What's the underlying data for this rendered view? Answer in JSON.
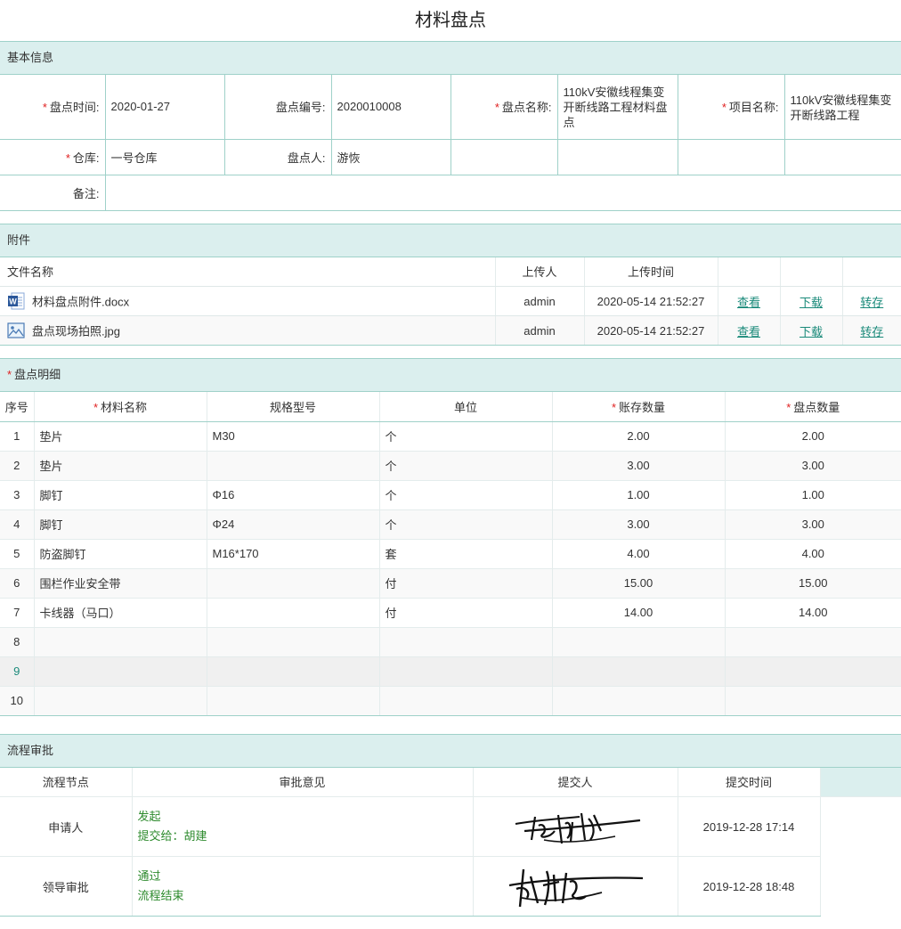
{
  "page": {
    "title": "材料盘点"
  },
  "basic": {
    "header": "基本信息",
    "date_label": "盘点时间:",
    "date_value": "2020-01-27",
    "no_label": "盘点编号:",
    "no_value": "2020010008",
    "name_label": "盘点名称:",
    "name_value": "110kV安徽线程集变开断线路工程材料盘点",
    "project_label": "项目名称:",
    "project_value": "110kV安徽线程集变开断线路工程",
    "warehouse_label": "仓库:",
    "warehouse_value": "一号仓库",
    "person_label": "盘点人:",
    "person_value": "游恢",
    "remark_label": "备注:",
    "remark_value": ""
  },
  "attachments": {
    "header": "附件",
    "columns": {
      "file": "文件名称",
      "uploader": "上传人",
      "time": "上传时间"
    },
    "files": [
      {
        "name": "材料盘点附件.docx",
        "icon": "word-file-icon",
        "uploader": "admin",
        "time": "2020-05-14 21:52:27",
        "view": "查看",
        "download": "下载",
        "save": "转存"
      },
      {
        "name": "盘点现场拍照.jpg",
        "icon": "image-file-icon",
        "uploader": "admin",
        "time": "2020-05-14 21:52:27",
        "view": "查看",
        "download": "下载",
        "save": "转存"
      }
    ]
  },
  "detail": {
    "header": "盘点明细",
    "columns": {
      "idx": "序号",
      "material": "材料名称",
      "spec": "规格型号",
      "unit": "单位",
      "stock": "账存数量",
      "count": "盘点数量"
    },
    "rows": [
      {
        "idx": "1",
        "material": "垫片",
        "spec": "M30",
        "unit": "个",
        "stock": "2.00",
        "count": "2.00"
      },
      {
        "idx": "2",
        "material": "垫片",
        "spec": "",
        "unit": "个",
        "stock": "3.00",
        "count": "3.00"
      },
      {
        "idx": "3",
        "material": "脚钉",
        "spec": "Φ16",
        "unit": "个",
        "stock": "1.00",
        "count": "1.00"
      },
      {
        "idx": "4",
        "material": "脚钉",
        "spec": "Φ24",
        "unit": "个",
        "stock": "3.00",
        "count": "3.00"
      },
      {
        "idx": "5",
        "material": "防盗脚钉",
        "spec": "M16*170",
        "unit": "套",
        "stock": "4.00",
        "count": "4.00"
      },
      {
        "idx": "6",
        "material": "围栏作业安全带",
        "spec": "",
        "unit": "付",
        "stock": "15.00",
        "count": "15.00"
      },
      {
        "idx": "7",
        "material": "卡线器（马口）",
        "spec": "",
        "unit": "付",
        "stock": "14.00",
        "count": "14.00"
      },
      {
        "idx": "8",
        "material": "",
        "spec": "",
        "unit": "",
        "stock": "",
        "count": ""
      },
      {
        "idx": "9",
        "material": "",
        "spec": "",
        "unit": "",
        "stock": "",
        "count": ""
      },
      {
        "idx": "10",
        "material": "",
        "spec": "",
        "unit": "",
        "stock": "",
        "count": ""
      }
    ]
  },
  "flow": {
    "header": "流程审批",
    "columns": {
      "node": "流程节点",
      "opinion": "审批意见",
      "submitter": "提交人",
      "time": "提交时间"
    },
    "rows": [
      {
        "node": "申请人",
        "opinion_line1": "发起",
        "opinion_line2": "提交给：胡建",
        "time": "2019-12-28 17:14"
      },
      {
        "node": "领导审批",
        "opinion_line1": "通过",
        "opinion_line2": "流程结束",
        "time": "2019-12-28 18:48"
      }
    ]
  },
  "colors": {
    "accent": "#1a8a7a",
    "header_bg": "#dbefee",
    "border": "#9fd1c9",
    "required": "#e02020",
    "approve_text": "#2e8b2e"
  }
}
